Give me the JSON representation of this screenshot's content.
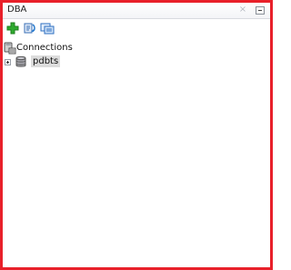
{
  "panel": {
    "title": "DBA",
    "close_glyph": "×"
  },
  "toolbar": {
    "buttons": [
      {
        "icon": "add-icon",
        "label": ""
      },
      {
        "icon": "refresh-icon",
        "label": ""
      },
      {
        "icon": "filter-icon",
        "label": ""
      }
    ]
  },
  "tree": {
    "root": {
      "label": "Connections",
      "icon": "connections-icon"
    },
    "children": [
      {
        "label": "pdbts",
        "icon": "database-icon",
        "expanded": false,
        "selected": true
      }
    ]
  },
  "colors": {
    "frame_border": "#e8202a",
    "add_icon": "#2faa2f",
    "selection": "#dcdcdc"
  }
}
